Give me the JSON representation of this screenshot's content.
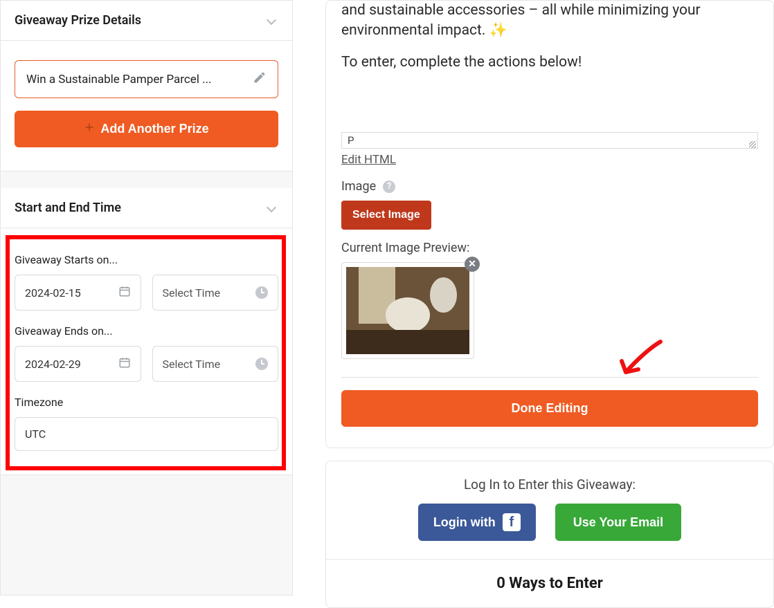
{
  "sidebar": {
    "prize_panel_title": "Giveaway Prize Details",
    "prize_name": "Win a Sustainable Pamper Parcel ...",
    "add_prize_label": "Add Another Prize",
    "time_panel_title": "Start and End Time",
    "starts_label": "Giveaway Starts on...",
    "start_date": "2024-02-15",
    "start_time_placeholder": "Select Time",
    "ends_label": "Giveaway Ends on...",
    "end_date": "2024-02-29",
    "end_time_placeholder": "Select Time",
    "timezone_label": "Timezone",
    "timezone_value": "UTC"
  },
  "editor": {
    "desc_line1": "and sustainable accessories – all while minimizing your environmental impact. ✨",
    "desc_line2": "To enter, complete the actions below!",
    "status_tag": "P",
    "edit_html_label": "Edit HTML",
    "image_label": "Image",
    "select_image_label": "Select Image",
    "preview_label": "Current Image Preview:",
    "done_label": "Done Editing"
  },
  "login": {
    "title": "Log In to Enter this Giveaway:",
    "fb_label": "Login with",
    "email_label": "Use Your Email"
  },
  "ways": {
    "title": "0 Ways to Enter"
  }
}
